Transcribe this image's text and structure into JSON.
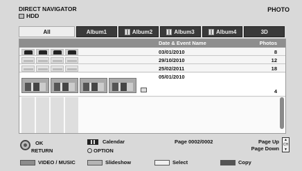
{
  "header": {
    "title": "DIRECT NAVIGATOR",
    "drive": "HDD",
    "mode": "PHOTO"
  },
  "tabs": [
    {
      "label": "All",
      "active": true
    },
    {
      "label": "Album1",
      "active": false
    },
    {
      "label": "Album2",
      "active": false
    },
    {
      "label": "Album3",
      "active": false
    },
    {
      "label": "Album4",
      "active": false
    },
    {
      "label": "3D",
      "active": false
    }
  ],
  "list": {
    "col_date": "Date & Event Name",
    "col_photos": "Photos",
    "rows": [
      {
        "date": "03/01/2010",
        "photos": "8"
      },
      {
        "date": "29/10/2010",
        "photos": "12"
      },
      {
        "date": "25/02/2011",
        "photos": "18"
      },
      {
        "date": "05/01/2010",
        "photos": "4"
      }
    ]
  },
  "footer": {
    "ok": "OK",
    "return": "RETURN",
    "calendar": "Calendar",
    "option": "OPTION",
    "page": "Page 0002/0002",
    "page_up": "Page Up",
    "page_down": "Page Down",
    "ch_label": "CH"
  },
  "color_buttons": [
    {
      "label": "VIDEO / MUSIC",
      "color": "#8c8c8c"
    },
    {
      "label": "Slideshow",
      "color": "#b4b4b4"
    },
    {
      "label": "Select",
      "color": "#f0f0f0"
    },
    {
      "label": "Copy",
      "color": "#555555"
    }
  ],
  "colors": {
    "active_tab": "#eeeeee",
    "inactive_tab": "#3a3a3a",
    "list_header": "#8e8e8e"
  }
}
